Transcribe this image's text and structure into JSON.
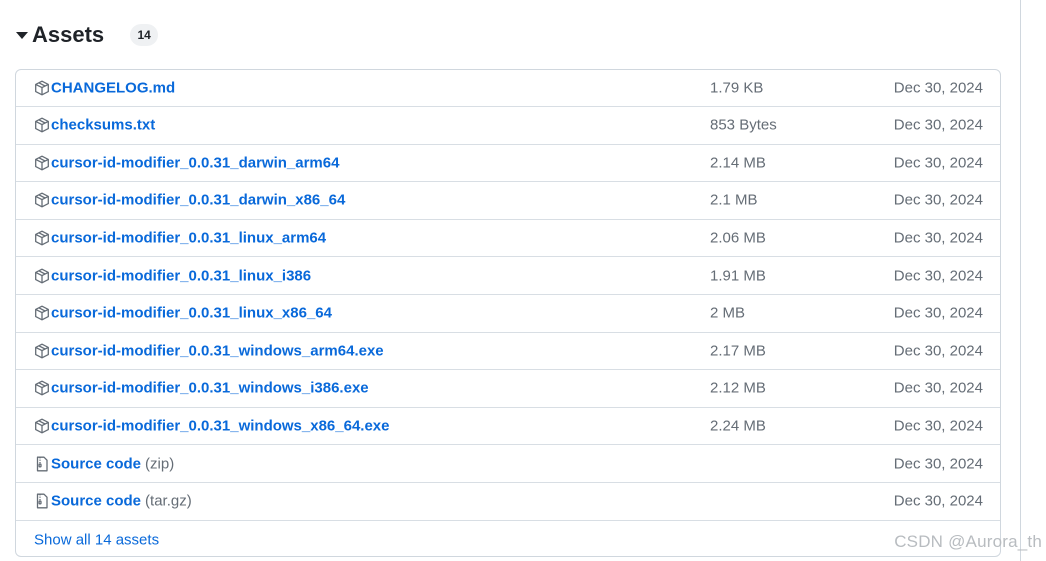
{
  "assets": {
    "title": "Assets",
    "count": "14",
    "items": [
      {
        "name": "CHANGELOG.md",
        "suffix": "",
        "icon": "package-icon",
        "size": "1.79 KB",
        "date": "Dec 30, 2024"
      },
      {
        "name": "checksums.txt",
        "suffix": "",
        "icon": "package-icon",
        "size": "853 Bytes",
        "date": "Dec 30, 2024"
      },
      {
        "name": "cursor-id-modifier_0.0.31_darwin_arm64",
        "suffix": "",
        "icon": "package-icon",
        "size": "2.14 MB",
        "date": "Dec 30, 2024"
      },
      {
        "name": "cursor-id-modifier_0.0.31_darwin_x86_64",
        "suffix": "",
        "icon": "package-icon",
        "size": "2.1 MB",
        "date": "Dec 30, 2024"
      },
      {
        "name": "cursor-id-modifier_0.0.31_linux_arm64",
        "suffix": "",
        "icon": "package-icon",
        "size": "2.06 MB",
        "date": "Dec 30, 2024"
      },
      {
        "name": "cursor-id-modifier_0.0.31_linux_i386",
        "suffix": "",
        "icon": "package-icon",
        "size": "1.91 MB",
        "date": "Dec 30, 2024"
      },
      {
        "name": "cursor-id-modifier_0.0.31_linux_x86_64",
        "suffix": "",
        "icon": "package-icon",
        "size": "2 MB",
        "date": "Dec 30, 2024"
      },
      {
        "name": "cursor-id-modifier_0.0.31_windows_arm64.exe",
        "suffix": "",
        "icon": "package-icon",
        "size": "2.17 MB",
        "date": "Dec 30, 2024"
      },
      {
        "name": "cursor-id-modifier_0.0.31_windows_i386.exe",
        "suffix": "",
        "icon": "package-icon",
        "size": "2.12 MB",
        "date": "Dec 30, 2024"
      },
      {
        "name": "cursor-id-modifier_0.0.31_windows_x86_64.exe",
        "suffix": "",
        "icon": "package-icon",
        "size": "2.24 MB",
        "date": "Dec 30, 2024"
      },
      {
        "name": "Source code",
        "suffix": "(zip)",
        "icon": "file-zip-icon",
        "size": "",
        "date": "Dec 30, 2024"
      },
      {
        "name": "Source code",
        "suffix": "(tar.gz)",
        "icon": "file-zip-icon",
        "size": "",
        "date": "Dec 30, 2024"
      }
    ],
    "show_all_label": "Show all 14 assets"
  },
  "watermark": "CSDN @Aurora_th",
  "colors": {
    "link": "#0969da",
    "muted": "#656d76",
    "border": "#d0d7de"
  }
}
